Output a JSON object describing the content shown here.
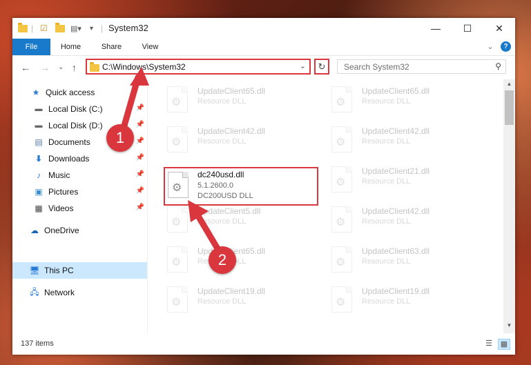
{
  "window": {
    "title": "System32"
  },
  "titlebar": {
    "minimize": "—",
    "maximize": "☐",
    "close": "✕"
  },
  "ribbon": {
    "tabs": [
      "File",
      "Home",
      "Share",
      "View"
    ],
    "help": "?",
    "collapse": "⌄"
  },
  "address": {
    "path": "C:\\Windows\\System32",
    "refresh_icon": "↻",
    "dropdown": "⌄"
  },
  "search": {
    "placeholder": "Search System32"
  },
  "nav": {
    "back": "←",
    "forward": "→",
    "recent": "⌄",
    "up": "↑"
  },
  "sidebar": {
    "items": [
      {
        "label": "Quick access",
        "icon": "star-icon",
        "pinned": false
      },
      {
        "label": "Local Disk (C:)",
        "icon": "drive-icon",
        "pinned": true
      },
      {
        "label": "Local Disk (D:)",
        "icon": "drive-icon",
        "pinned": true
      },
      {
        "label": "Documents",
        "icon": "document-icon",
        "pinned": true
      },
      {
        "label": "Downloads",
        "icon": "download-icon",
        "pinned": true
      },
      {
        "label": "Music",
        "icon": "music-icon",
        "pinned": true
      },
      {
        "label": "Pictures",
        "icon": "pictures-icon",
        "pinned": true
      },
      {
        "label": "Videos",
        "icon": "videos-icon",
        "pinned": true
      },
      {
        "label": "OneDrive",
        "icon": "cloud-icon",
        "pinned": false
      },
      {
        "label": "This PC",
        "icon": "computer-icon",
        "pinned": false,
        "selected": true
      },
      {
        "label": "Network",
        "icon": "network-icon",
        "pinned": false
      }
    ]
  },
  "files": {
    "left": [
      {
        "name": "UpdateClient65.dll",
        "type": "Resource DLL"
      },
      {
        "name": "UpdateClient42.dll",
        "type": "Resource DLL"
      },
      {
        "name": "UpdateClient5.dll",
        "type": "Resource DLL"
      },
      {
        "name": "UpdateClient65.dll",
        "type": "Resource DLL"
      },
      {
        "name": "UpdateClient19.dll",
        "type": "Resource DLL"
      }
    ],
    "right": [
      {
        "name": "UpdateClient65.dll",
        "type": "Resource DLL"
      },
      {
        "name": "UpdateClient42.dll",
        "type": "Resource DLL"
      },
      {
        "name": "UpdateClient21.dll",
        "type": "Resource DLL"
      },
      {
        "name": "UpdateClient42.dll",
        "type": "Resource DLL"
      },
      {
        "name": "UpdateClient63.dll",
        "type": "Resource DLL"
      },
      {
        "name": "UpdateClient19.dll",
        "type": "Resource DLL"
      }
    ],
    "highlighted": {
      "name": "dc240usd.dll",
      "version": "5.1.2600.0",
      "description": "DC200USD DLL"
    }
  },
  "status": {
    "count": "137 items"
  },
  "callouts": {
    "one": "1",
    "two": "2"
  },
  "colors": {
    "accent": "#1979ca",
    "callout": "#d9363e",
    "selection": "#cce8ff"
  }
}
